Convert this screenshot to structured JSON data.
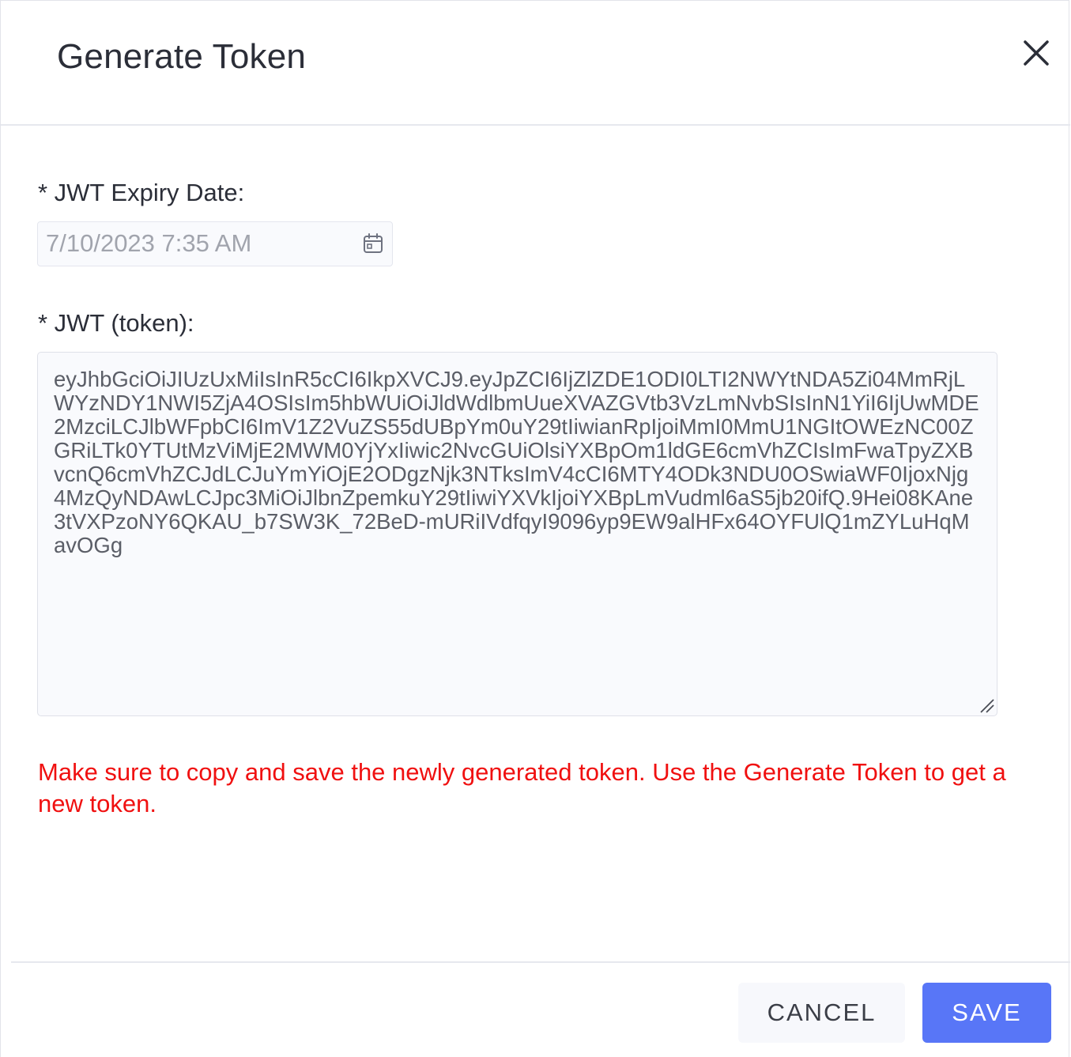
{
  "dialog": {
    "title": "Generate Token",
    "close_icon": "close-icon"
  },
  "expiry": {
    "label": "* JWT Expiry Date:",
    "value": "7/10/2023 7:35 AM",
    "icon": "calendar-icon"
  },
  "token": {
    "label": "* JWT (token):",
    "value": "eyJhbGciOiJIUzUxMiIsInR5cCI6IkpXVCJ9.eyJpZCI6IjZlZDE1ODI0LTI2NWYtNDA5Zi04MmRjLWYzNDY1NWI5ZjA4OSIsIm5hbWUiOiJldWdlbmUueXVAZGVtb3VzLmNvbSIsInN1YiI6IjUwMDE2MzciLCJlbWFpbCI6ImV1Z2VuZS55dUBpYm0uY29tIiwianRpIjoiMmI0MmU1NGItOWEzNC00ZGRiLTk0YTUtMzViMjE2MWM0YjYxIiwic2NvcGUiOlsiYXBpOm1ldGE6cmVhZCIsImFwaTpyZXBvcnQ6cmVhZCJdLCJuYmYiOjE2ODgzNjk3NTksImV4cCI6MTY4ODk3NDU0OSwiaWF0IjoxNjg4MzQyNDAwLCJpc3MiOiJlbnZpemkuY29tIiwiYXVkIjoiYXBpLmVudml6aS5jb20ifQ.9Hei08KAne3tVXPzoNY6QKAU_b7SW3K_72BeD-mURiIVdfqyI9096yp9EW9alHFx64OYFUlQ1mZYLuHqMavOGg"
  },
  "warning": "Make sure to copy and save the newly generated token. Use the Generate Token to get a new token.",
  "buttons": {
    "cancel": "CANCEL",
    "save": "SAVE"
  },
  "colors": {
    "primary": "#5876f7",
    "warning": "#f01010",
    "input_bg": "#f9fafd"
  }
}
